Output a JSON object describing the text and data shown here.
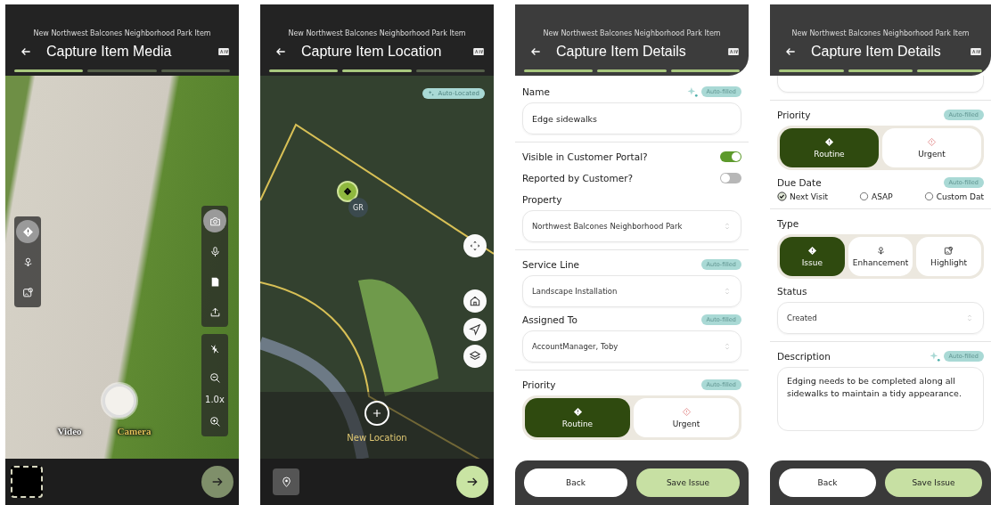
{
  "screens": [
    {
      "kind": "media",
      "subtitle": "New Northwest Balcones Neighborhood Park Item",
      "title": "Capture Item Media",
      "steps": [
        {
          "done": true
        },
        {
          "done": false
        },
        {
          "done": false
        }
      ],
      "side_tools": [
        {
          "kind": "issue",
          "selected": true
        },
        {
          "kind": "enhancement",
          "selected": false
        },
        {
          "kind": "highlight",
          "selected": false
        }
      ],
      "capture_tools": [
        {
          "kind": "camera",
          "selected": true
        },
        {
          "kind": "mic",
          "selected": false
        },
        {
          "kind": "file",
          "selected": false
        },
        {
          "kind": "upload",
          "selected": false
        }
      ],
      "zoom_level": "1.0x",
      "modes": [
        {
          "label": "Video",
          "selected": false
        },
        {
          "label": "Camera",
          "selected": true
        }
      ]
    },
    {
      "kind": "location",
      "subtitle": "New Northwest Balcones Neighborhood Park Item",
      "title": "Capture Item Location",
      "steps": [
        {
          "done": true
        },
        {
          "done": true
        },
        {
          "done": false
        }
      ],
      "badge": "Auto-Located",
      "marker_label": "GR",
      "map_tools": [
        {
          "kind": "recenter"
        },
        {
          "kind": "home"
        },
        {
          "kind": "navigate"
        },
        {
          "kind": "layers"
        }
      ],
      "add_label": "New Location"
    },
    {
      "kind": "details",
      "subtitle": "New Northwest Balcones Neighborhood Park Item",
      "title": "Capture Item Details",
      "steps": [
        {
          "done": true
        },
        {
          "done": true
        },
        {
          "done": true
        }
      ],
      "fields": [
        {
          "kind": "text",
          "label": "Name",
          "value": "Edge sidewalks",
          "badge": "Auto-filled",
          "sparkle": true,
          "divider": true
        },
        {
          "kind": "toggle",
          "label": "Visible in Customer Portal?",
          "on": true
        },
        {
          "kind": "toggle",
          "label": "Reported by Customer?",
          "on": false
        },
        {
          "kind": "select",
          "label": "Property",
          "value": "Northwest Balcones Neighborhood Park",
          "divider": true
        },
        {
          "kind": "select",
          "label": "Service Line",
          "value": "Landscape Installation",
          "badge": "Auto-filled"
        },
        {
          "kind": "select",
          "label": "Assigned To",
          "value": "AccountManager, Toby",
          "badge": "Auto-filled",
          "divider": true
        },
        {
          "kind": "segmented",
          "label": "Priority",
          "badge": "Auto-filled",
          "options": [
            {
              "kind": "issue",
              "label": "Routine",
              "selected": true
            },
            {
              "kind": "urgent",
              "label": "Urgent",
              "selected": false
            }
          ]
        }
      ],
      "buttons": [
        {
          "kind": "secondary",
          "label": "Back"
        },
        {
          "kind": "primary",
          "label": "Save Issue"
        }
      ]
    },
    {
      "kind": "details",
      "subtitle": "New Northwest Balcones Neighborhood Park Item",
      "title": "Capture Item Details",
      "steps": [
        {
          "done": true
        },
        {
          "done": true
        },
        {
          "done": true
        }
      ],
      "fields": [
        {
          "kind": "select_tail",
          "divider": true
        },
        {
          "kind": "segmented",
          "label": "Priority",
          "badge": "Auto-filled",
          "options": [
            {
              "kind": "issue",
              "label": "Routine",
              "selected": true
            },
            {
              "kind": "urgent",
              "label": "Urgent",
              "selected": false
            }
          ]
        },
        {
          "kind": "radios",
          "label": "Due Date",
          "badge": "Auto-filled",
          "divider": true,
          "options": [
            {
              "label": "Next Visit",
              "selected": true
            },
            {
              "label": "ASAP",
              "selected": false
            },
            {
              "label": "Custom Dat",
              "selected": false
            }
          ]
        },
        {
          "kind": "segmented",
          "label": "Type",
          "options": [
            {
              "kind": "issue",
              "label": "Issue",
              "selected": true
            },
            {
              "kind": "enhancement",
              "label": "Enhancement",
              "selected": false
            },
            {
              "kind": "highlight",
              "label": "Highlight",
              "selected": false
            }
          ]
        },
        {
          "kind": "select",
          "label": "Status",
          "value": "Created",
          "divider": true
        },
        {
          "kind": "textarea",
          "label": "Description",
          "value": "Edging needs to be completed along all sidewalks to maintain a tidy appearance.",
          "badge": "Auto-filled",
          "sparkle": true
        }
      ],
      "buttons": [
        {
          "kind": "secondary",
          "label": "Back"
        },
        {
          "kind": "primary",
          "label": "Save Issue"
        }
      ]
    }
  ]
}
